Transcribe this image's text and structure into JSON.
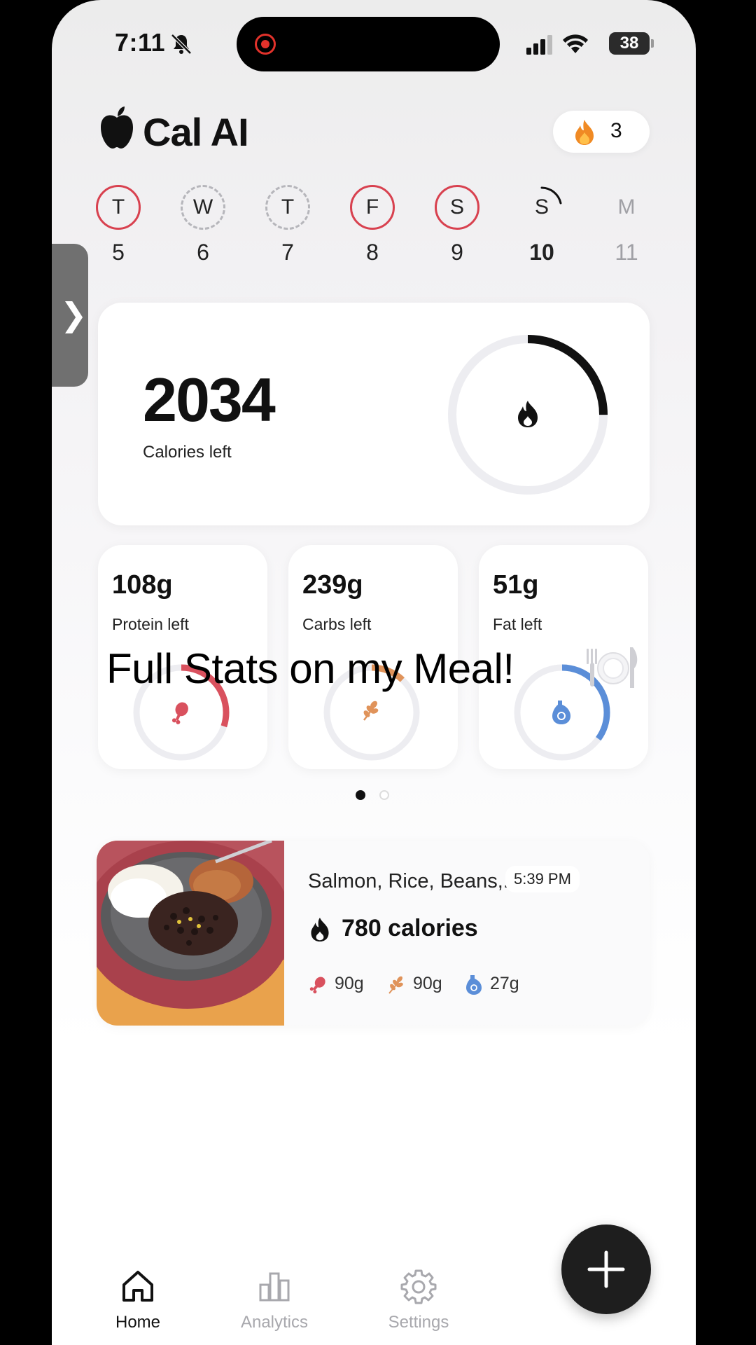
{
  "status_bar": {
    "time": "7:11",
    "battery": "38"
  },
  "header": {
    "app_title": "Cal AI",
    "streak_count": "3"
  },
  "week": [
    {
      "letter": "T",
      "day": "5",
      "state": "done"
    },
    {
      "letter": "W",
      "day": "6",
      "state": "partial"
    },
    {
      "letter": "T",
      "day": "7",
      "state": "partial"
    },
    {
      "letter": "F",
      "day": "8",
      "state": "done"
    },
    {
      "letter": "S",
      "day": "9",
      "state": "done"
    },
    {
      "letter": "S",
      "day": "10",
      "state": "today"
    },
    {
      "letter": "M",
      "day": "11",
      "state": "future"
    }
  ],
  "calories": {
    "value": "2034",
    "label": "Calories left",
    "progress": 0.25
  },
  "macros": [
    {
      "value": "108g",
      "label": "Protein left",
      "color": "#d9515e",
      "progress": 0.3,
      "icon": "drumstick-icon"
    },
    {
      "value": "239g",
      "label": "Carbs left",
      "color": "#e0935a",
      "progress": 0.12,
      "icon": "wheat-icon"
    },
    {
      "value": "51g",
      "label": "Fat left",
      "color": "#5b8ed8",
      "progress": 0.35,
      "icon": "oil-drop-icon"
    }
  ],
  "overlay_caption": "Full Stats on my Meal!",
  "meal": {
    "name": "Salmon, Rice, Beans,...",
    "time": "5:39 PM",
    "calories": "780 calories",
    "protein": "90g",
    "carbs": "90g",
    "fat": "27g"
  },
  "nav": {
    "home": "Home",
    "analytics": "Analytics",
    "settings": "Settings"
  },
  "colors": {
    "accent_red": "#d8414f",
    "ring_track": "#ededf1",
    "fab": "#1e1e1e"
  }
}
